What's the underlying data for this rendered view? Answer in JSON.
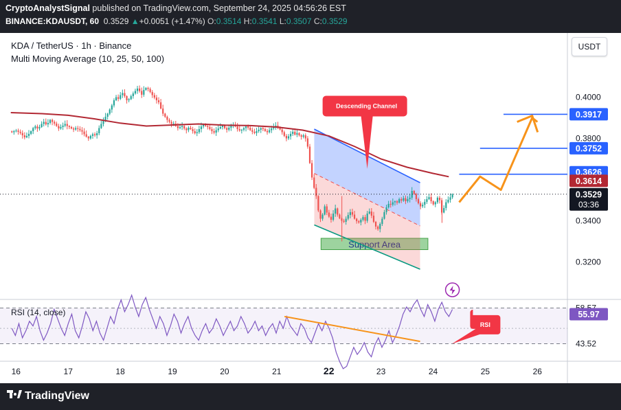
{
  "header": {
    "author": "CryptoAnalystSignal",
    "published_text": " published on TradingView.com, September 24, 2025 04:56:26 EST",
    "symbol_full": "BINANCE:KDAUSDT, 60",
    "last": "0.3529",
    "change": "+0.0051 (+1.47%)",
    "o_label": "O:",
    "o": "0.3514",
    "h_label": "H:",
    "h": "0.3541",
    "l_label": "L:",
    "l": "0.3507",
    "c_label": "C:",
    "c": "0.3529"
  },
  "legend": {
    "title": "KDA / TetherUS · 1h · Binance",
    "indicator": "Multi Moving Average (10, 25, 50, 100)",
    "rsi": "RSI (14, close)"
  },
  "currency_button": "USDT",
  "footer": {
    "brand": "TradingView"
  },
  "colors": {
    "up": "#26a69a",
    "down": "#ef5350",
    "ma": "#b22833",
    "channel_blue": "#2962ff",
    "channel_green": "#089981",
    "projection": "#f7931a",
    "rsi": "#7e57c2",
    "rsi_trend": "#f7931a",
    "callout": "#f23645",
    "price_tag": "#131722",
    "level_tag": "#2962ff"
  },
  "chart_data": {
    "type": "candlestick",
    "title": "KDA / TetherUS · 1h · Binance",
    "x_ticks": [
      "16",
      "17",
      "18",
      "19",
      "20",
      "21",
      "22",
      "23",
      "24",
      "25",
      "26"
    ],
    "x_tick_bold": "22",
    "y_ticks": [
      "0.4000",
      "0.3800",
      "0.3400",
      "0.3200"
    ],
    "y_range": [
      0.308,
      0.423
    ],
    "price_series_hourly_close": [
      0.383,
      0.3835,
      0.3838,
      0.3832,
      0.3826,
      0.3815,
      0.3805,
      0.3812,
      0.3822,
      0.3835,
      0.385,
      0.3858,
      0.3848,
      0.3855,
      0.387,
      0.388,
      0.3868,
      0.3875,
      0.389,
      0.388,
      0.3872,
      0.386,
      0.3848,
      0.3855,
      0.3862,
      0.387,
      0.386,
      0.3855,
      0.3848,
      0.3843,
      0.385,
      0.3846,
      0.384,
      0.3833,
      0.382,
      0.3808,
      0.38,
      0.3812,
      0.382,
      0.3815,
      0.3825,
      0.385,
      0.387,
      0.3885,
      0.3905,
      0.392,
      0.394,
      0.396,
      0.3985,
      0.4,
      0.3992,
      0.401,
      0.402,
      0.4005,
      0.3985,
      0.399,
      0.4005,
      0.4018,
      0.403,
      0.4042,
      0.403,
      0.4012,
      0.4035,
      0.4045,
      0.404,
      0.4025,
      0.401,
      0.3998,
      0.3985,
      0.3975,
      0.3945,
      0.392,
      0.3905,
      0.389,
      0.388,
      0.387,
      0.3872,
      0.386,
      0.385,
      0.3855,
      0.386,
      0.3848,
      0.384,
      0.3852,
      0.3845,
      0.3835,
      0.3825,
      0.383,
      0.3845,
      0.3858,
      0.3868,
      0.386,
      0.3855,
      0.3845,
      0.3835,
      0.3828,
      0.384,
      0.3848,
      0.3855,
      0.3862,
      0.385,
      0.3842,
      0.3852,
      0.386,
      0.3865,
      0.3858,
      0.3845,
      0.3838,
      0.3842,
      0.385,
      0.3858,
      0.3852,
      0.384,
      0.3832,
      0.3826,
      0.3835,
      0.3842,
      0.385,
      0.3845,
      0.3836,
      0.383,
      0.384,
      0.3848,
      0.3858,
      0.3862,
      0.3855,
      0.3843,
      0.383,
      0.3812,
      0.38,
      0.381,
      0.3822,
      0.3832,
      0.3818,
      0.3826,
      0.3815,
      0.3808,
      0.3815,
      0.38,
      0.376,
      0.368,
      0.361,
      0.356,
      0.352,
      0.345,
      0.341,
      0.343,
      0.347,
      0.344,
      0.342,
      0.3405,
      0.3435,
      0.346,
      0.343,
      0.3412,
      0.34,
      0.3395,
      0.341,
      0.3428,
      0.3442,
      0.343,
      0.341,
      0.3398,
      0.3392,
      0.3405,
      0.3418,
      0.34,
      0.3435,
      0.3445,
      0.3425,
      0.3395,
      0.3372,
      0.336,
      0.3385,
      0.341,
      0.3442,
      0.3465,
      0.3482,
      0.3478,
      0.349,
      0.3495,
      0.3488,
      0.3505,
      0.3498,
      0.351,
      0.3495,
      0.3505,
      0.3512,
      0.3545,
      0.353,
      0.3505,
      0.3485,
      0.347,
      0.3478,
      0.3492,
      0.3505,
      0.3515,
      0.3495,
      0.348,
      0.349,
      0.3512,
      0.35,
      0.344,
      0.3462,
      0.349,
      0.3502,
      0.3514,
      0.3529
    ],
    "moving_average_100": {
      "x_day": [
        15.9,
        16.5,
        17.0,
        17.5,
        18.0,
        18.5,
        19.0,
        19.5,
        20.0,
        20.5,
        21.0,
        21.5,
        22.0,
        22.5,
        23.0,
        23.5,
        24.0,
        24.3
      ],
      "values": [
        0.3925,
        0.392,
        0.3912,
        0.3895,
        0.3874,
        0.386,
        0.3865,
        0.387,
        0.3864,
        0.3862,
        0.3855,
        0.384,
        0.3812,
        0.376,
        0.37,
        0.366,
        0.363,
        0.3614
      ]
    },
    "descending_channel": {
      "upper": [
        [
          21.72,
          0.3845
        ],
        [
          23.75,
          0.3585
        ]
      ],
      "lower": [
        [
          21.72,
          0.338
        ],
        [
          23.75,
          0.3165
        ]
      ],
      "mid": [
        [
          21.72,
          0.363
        ],
        [
          23.75,
          0.3375
        ]
      ]
    },
    "support_area": {
      "low": 0.326,
      "high": 0.3315,
      "x_from": 21.85,
      "x_to": 23.9,
      "label": "Support Area"
    },
    "callouts": [
      {
        "text": "Descending Channel"
      },
      {
        "text": "RSI"
      }
    ],
    "projection_path": [
      [
        24.5,
        0.349
      ],
      [
        24.9,
        0.3615
      ],
      [
        25.3,
        0.355
      ],
      [
        25.9,
        0.39
      ],
      [
        26.0,
        0.388
      ]
    ],
    "levels": [
      {
        "label": "0.3917",
        "value": 0.3917,
        "x_from": 25.35
      },
      {
        "label": "0.3752",
        "value": 0.3752,
        "x_from": 24.9
      },
      {
        "label": "0.3626",
        "value": 0.3626,
        "x_from": 24.5
      }
    ],
    "ma_tag": "0.3614",
    "price_tag": "0.3529",
    "countdown": "03:36",
    "rsi": {
      "label": "RSI (14, close)",
      "levels": [
        "58.57",
        "55.97",
        "43.52"
      ],
      "current": 55.97,
      "series": [
        50,
        47,
        52,
        46,
        49,
        53,
        51,
        55,
        49,
        45,
        48,
        52,
        58,
        54,
        50,
        47,
        52,
        56,
        49,
        46,
        51,
        57,
        54,
        49,
        53,
        48,
        45,
        50,
        55,
        52,
        58,
        62,
        57,
        60,
        64,
        59,
        55,
        60,
        63,
        58,
        54,
        50,
        55,
        52,
        47,
        51,
        56,
        53,
        48,
        52,
        55,
        50,
        47,
        45,
        49,
        52,
        48,
        50,
        54,
        51,
        47,
        50,
        53,
        49,
        51,
        55,
        52,
        48,
        50,
        53,
        49,
        51,
        47,
        50,
        52,
        48,
        53,
        50,
        55,
        51,
        49,
        47,
        52,
        50,
        46,
        44,
        48,
        52,
        49,
        53,
        50,
        46,
        40,
        36,
        33,
        34,
        38,
        42,
        39,
        41,
        44,
        40,
        38,
        43,
        46,
        42,
        45,
        49,
        44,
        47,
        51,
        56,
        59,
        57,
        60,
        62,
        58,
        55,
        60,
        57,
        53,
        58,
        61,
        57,
        55,
        58
      ],
      "trendline": {
        "from_value": 55.0,
        "to_value": 44.5
      }
    }
  }
}
